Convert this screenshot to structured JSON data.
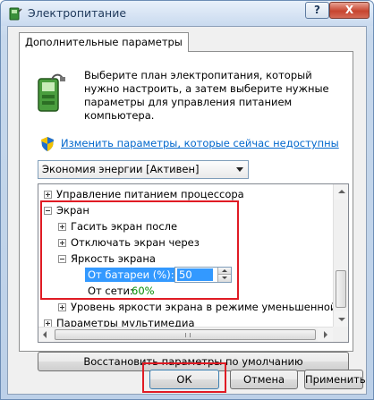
{
  "window": {
    "title": "Электропитание",
    "help_label": "?",
    "close_label": "X"
  },
  "tab": {
    "label": "Дополнительные параметры"
  },
  "description": "Выберите план электропитания, который нужно настроить, а затем выберите нужные параметры для управления питанием компьютера.",
  "uac_link": "Изменить параметры, которые сейчас недоступны",
  "plan_select": {
    "value": "Экономия энергии [Активен]"
  },
  "tree": {
    "items": [
      {
        "label": "Управление питанием процессора"
      },
      {
        "label": "Экран"
      },
      {
        "label": "Гасить экран после"
      },
      {
        "label": "Отключать экран через"
      },
      {
        "label": "Яркость экрана"
      },
      {
        "label": "Уровень яркости экрана в режиме уменьшенной яр"
      },
      {
        "label": "Параметры мультимедиа"
      }
    ],
    "battery": {
      "label": "От батареи (%):",
      "value": "50"
    },
    "ac": {
      "label": "От сети:",
      "value": "60%"
    }
  },
  "buttons": {
    "restore": "Восстановить параметры по умолчанию",
    "ok": "ОК",
    "cancel": "Отмена",
    "apply": "Применить"
  },
  "colors": {
    "highlight": "#3399ff",
    "annotation_red": "#e01b24",
    "link": "#0066cc",
    "ac_value": "#008a00"
  }
}
